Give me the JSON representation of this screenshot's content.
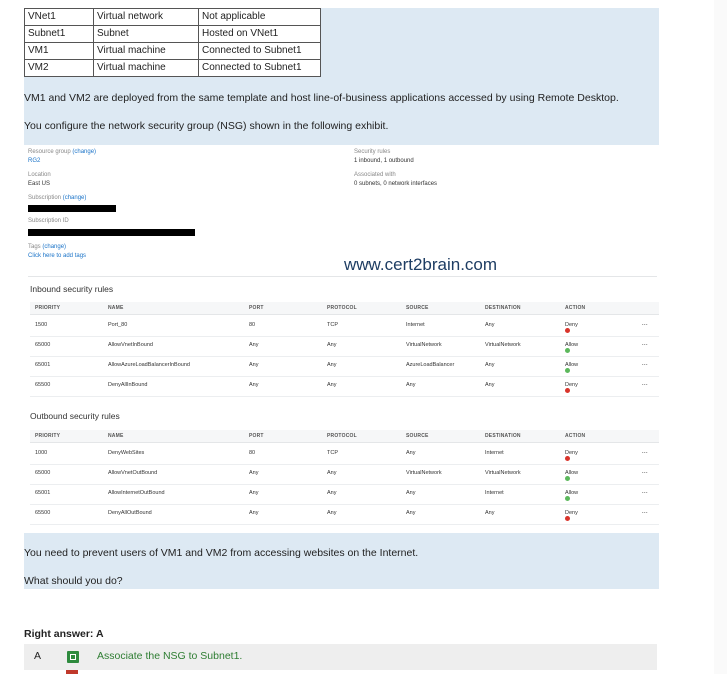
{
  "question": {
    "table": [
      [
        "VNet1",
        "Virtual network",
        "Not applicable"
      ],
      [
        "Subnet1",
        "Subnet",
        "Hosted on VNet1"
      ],
      [
        "VM1",
        "Virtual machine",
        "Connected to Subnet1"
      ],
      [
        "VM2",
        "Virtual machine",
        "Connected to Subnet1"
      ]
    ],
    "para1": "VM1 and VM2 are deployed from the same template and host line-of-business applications accessed by using Remote Desktop.",
    "para2": "You configure the network security group (NSG) shown in the following exhibit.",
    "para3": "You need to prevent users of VM1 and VM2 from accessing websites on the Internet.",
    "para4": "What should you do?"
  },
  "exhibit": {
    "resource_group_label": "Resource group",
    "change_link": "(change)",
    "resource_group_value": "RG2",
    "location_label": "Location",
    "location_value": "East US",
    "subscription_label": "Subscription",
    "subscription_id_label": "Subscription ID",
    "tags_label": "Tags",
    "tags_link": "Click here to add tags",
    "security_rules_label": "Security rules",
    "security_rules_value": "1 inbound, 1 outbound",
    "associated_label": "Associated with",
    "associated_value": "0 subnets, 0 network interfaces",
    "collapse_glyph": "^",
    "inbound_title": "Inbound security rules",
    "outbound_title": "Outbound security rules",
    "columns": [
      "PRIORITY",
      "NAME",
      "PORT",
      "PROTOCOL",
      "SOURCE",
      "DESTINATION",
      "ACTION"
    ],
    "more_glyph": "...",
    "inbound_rules": [
      {
        "priority": "1500",
        "name": "Port_80",
        "port": "80",
        "protocol": "TCP",
        "source": "Internet",
        "destination": "Any",
        "action": "Deny"
      },
      {
        "priority": "65000",
        "name": "AllowVnetInBound",
        "port": "Any",
        "protocol": "Any",
        "source": "VirtualNetwork",
        "destination": "VirtualNetwork",
        "action": "Allow"
      },
      {
        "priority": "65001",
        "name": "AllowAzureLoadBalancerInBound",
        "port": "Any",
        "protocol": "Any",
        "source": "AzureLoadBalancer",
        "destination": "Any",
        "action": "Allow"
      },
      {
        "priority": "65500",
        "name": "DenyAllInBound",
        "port": "Any",
        "protocol": "Any",
        "source": "Any",
        "destination": "Any",
        "action": "Deny"
      }
    ],
    "outbound_rules": [
      {
        "priority": "1000",
        "name": "DenyWebSites",
        "port": "80",
        "protocol": "TCP",
        "source": "Any",
        "destination": "Internet",
        "action": "Deny"
      },
      {
        "priority": "65000",
        "name": "AllowVnetOutBound",
        "port": "Any",
        "protocol": "Any",
        "source": "VirtualNetwork",
        "destination": "VirtualNetwork",
        "action": "Allow"
      },
      {
        "priority": "65001",
        "name": "AllowInternetOutBound",
        "port": "Any",
        "protocol": "Any",
        "source": "Any",
        "destination": "Internet",
        "action": "Allow"
      },
      {
        "priority": "65500",
        "name": "DenyAllOutBound",
        "port": "Any",
        "protocol": "Any",
        "source": "Any",
        "destination": "Any",
        "action": "Deny"
      }
    ],
    "watermark": "www.cert2brain.com"
  },
  "answer": {
    "label": "Right answer: A",
    "option_letter": "A",
    "option_text": "Associate the NSG to Subnet1."
  },
  "colors": {
    "deny": "#d9342b",
    "allow": "#5cb85c",
    "panel": "#dde9f3",
    "answer_text": "#2e7d32"
  }
}
